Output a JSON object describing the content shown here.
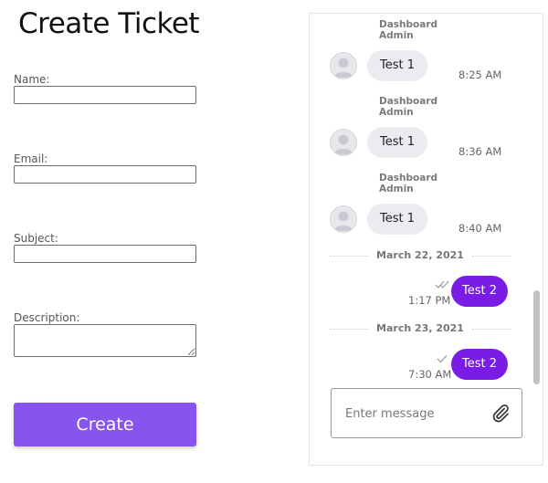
{
  "form": {
    "title": "Create Ticket",
    "name_label": "Name:",
    "email_label": "Email:",
    "subject_label": "Subject:",
    "description_label": "Description:",
    "name_value": "",
    "email_value": "",
    "subject_value": "",
    "description_value": "",
    "create_label": "Create"
  },
  "chat": {
    "incoming": [
      {
        "sender": "Dashboard Admin",
        "text": "Test 1",
        "time": "8:25 AM"
      },
      {
        "sender": "Dashboard Admin",
        "text": "Test 1",
        "time": "8:36 AM"
      },
      {
        "sender": "Dashboard Admin",
        "text": "Test 1",
        "time": "8:40 AM"
      }
    ],
    "dates": [
      "March 22, 2021",
      "March 23, 2021"
    ],
    "outgoing": [
      {
        "text": "Test 2",
        "time": "1:17 PM",
        "status": "read"
      },
      {
        "text": "Test 2",
        "time": "7:30 AM",
        "status": "sent"
      }
    ],
    "composer_placeholder": "Enter message",
    "attach_icon": "paperclip-icon"
  },
  "colors": {
    "accent_button": "#8854ee",
    "outgoing_bubble": "#7b1ce6",
    "incoming_bubble": "#ececf0"
  }
}
